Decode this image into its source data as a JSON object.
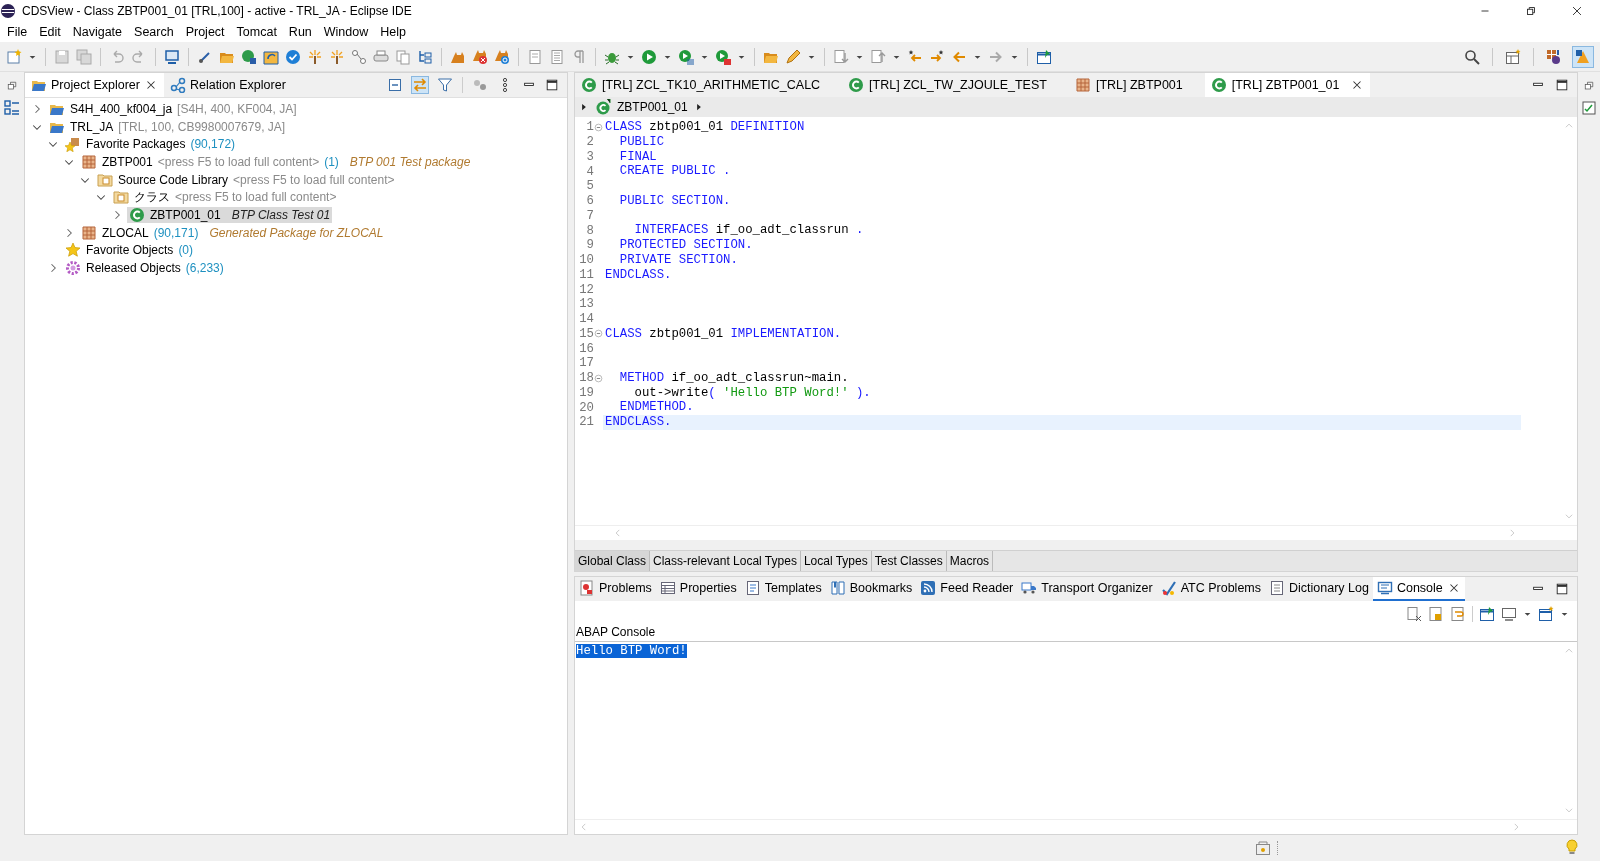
{
  "window": {
    "title": "CDSView - Class ZBTP001_01 [TRL,100] - active - TRL_JA - Eclipse IDE"
  },
  "menu": [
    "File",
    "Edit",
    "Navigate",
    "Search",
    "Project",
    "Tomcat",
    "Run",
    "Window",
    "Help"
  ],
  "explorer": {
    "tabs": [
      {
        "label": "Project Explorer",
        "kind": "project",
        "selected": true
      },
      {
        "label": "Relation Explorer",
        "kind": "relation",
        "selected": false
      }
    ],
    "tree": [
      {
        "label": "S4H_400_kf004_ja",
        "detail": "[S4H, 400, KF004, JA]",
        "kind": "project",
        "expanded": false,
        "selected": false
      },
      {
        "label": "TRL_JA",
        "detail": "[TRL, 100, CB9980007679, JA]",
        "kind": "project",
        "expanded": true,
        "selected": false,
        "children": [
          {
            "label": "Favorite Packages",
            "count": "(90,172)",
            "kind": "favorites",
            "expanded": true,
            "selected": false,
            "children": [
              {
                "label": "ZBTP001",
                "detail": "<press F5 to load full content>",
                "count": "(1)",
                "description": "BTP 001 Test package",
                "kind": "package",
                "expanded": true,
                "selected": false,
                "children": [
                  {
                    "label": "Source Code Library",
                    "detail": "<press F5 to load full content>",
                    "kind": "library",
                    "expanded": true,
                    "selected": false,
                    "children": [
                      {
                        "label": "クラス",
                        "detail": "<press F5 to load full content>",
                        "kind": "folder",
                        "expanded": true,
                        "selected": false,
                        "children": [
                          {
                            "label": "ZBTP001_01",
                            "description": "BTP Class Test 01",
                            "kind": "class",
                            "expanded": false,
                            "selected": true
                          }
                        ]
                      }
                    ]
                  }
                ]
              },
              {
                "label": "ZLOCAL",
                "count": "(90,171)",
                "description": "Generated Package for ZLOCAL",
                "kind": "package",
                "expanded": false,
                "selected": false
              }
            ]
          },
          {
            "label": "Favorite Objects",
            "count": "(0)",
            "kind": "star",
            "selected": false
          },
          {
            "label": "Released Objects",
            "count": "(6,233)",
            "kind": "gear",
            "expanded": false,
            "selected": false
          }
        ]
      }
    ]
  },
  "editor": {
    "tabs": [
      {
        "label": "[TRL] ZCL_TK10_ARITHMETIC_CALC",
        "kind": "class",
        "selected": false
      },
      {
        "label": "[TRL] ZCL_TW_ZJOULE_TEST",
        "kind": "class",
        "selected": false
      },
      {
        "label": "[TRL] ZBTP001",
        "kind": "package",
        "selected": false
      },
      {
        "label": "[TRL] ZBTP001_01",
        "kind": "class",
        "selected": true
      }
    ],
    "breadcrumb": "ZBTP001_01",
    "lines": [
      {
        "number": "1",
        "fold": true,
        "current": false,
        "tokens": [
          {
            "kind": "keyword",
            "text": "CLASS"
          },
          {
            "kind": "plain",
            "text": " zbtp001_01 "
          },
          {
            "kind": "keyword",
            "text": "DEFINITION"
          }
        ]
      },
      {
        "number": "2",
        "fold": false,
        "current": false,
        "tokens": [
          {
            "kind": "keyword",
            "text": "  PUBLIC"
          }
        ]
      },
      {
        "number": "3",
        "fold": false,
        "current": false,
        "tokens": [
          {
            "kind": "keyword",
            "text": "  FINAL"
          }
        ]
      },
      {
        "number": "4",
        "fold": false,
        "current": false,
        "tokens": [
          {
            "kind": "keyword",
            "text": "  CREATE PUBLIC ."
          }
        ]
      },
      {
        "number": "5",
        "fold": false,
        "current": false
      },
      {
        "number": "6",
        "fold": false,
        "current": false,
        "tokens": [
          {
            "kind": "keyword",
            "text": "  PUBLIC SECTION."
          }
        ]
      },
      {
        "number": "7",
        "fold": false,
        "current": false
      },
      {
        "number": "8",
        "fold": false,
        "current": false,
        "tokens": [
          {
            "kind": "keyword",
            "text": "    INTERFACES"
          },
          {
            "kind": "plain",
            "text": " if_oo_adt_classrun "
          },
          {
            "kind": "keyword",
            "text": "."
          }
        ]
      },
      {
        "number": "9",
        "fold": false,
        "current": false,
        "tokens": [
          {
            "kind": "keyword",
            "text": "  PROTECTED SECTION."
          }
        ]
      },
      {
        "number": "10",
        "fold": false,
        "current": false,
        "tokens": [
          {
            "kind": "keyword",
            "text": "  PRIVATE SECTION."
          }
        ]
      },
      {
        "number": "11",
        "fold": false,
        "current": false,
        "tokens": [
          {
            "kind": "keyword",
            "text": "ENDCLASS."
          }
        ]
      },
      {
        "number": "12",
        "fold": false,
        "current": false
      },
      {
        "number": "13",
        "fold": false,
        "current": false
      },
      {
        "number": "14",
        "fold": false,
        "current": false
      },
      {
        "number": "15",
        "fold": true,
        "current": false,
        "tokens": [
          {
            "kind": "keyword",
            "text": "CLASS"
          },
          {
            "kind": "plain",
            "text": " zbtp001_01 "
          },
          {
            "kind": "keyword",
            "text": "IMPLEMENTATION."
          }
        ]
      },
      {
        "number": "16",
        "fold": false,
        "current": false
      },
      {
        "number": "17",
        "fold": false,
        "current": false
      },
      {
        "number": "18",
        "fold": true,
        "current": false,
        "tokens": [
          {
            "kind": "keyword",
            "text": "  METHOD"
          },
          {
            "kind": "plain",
            "text": " if_oo_adt_classrun~main."
          }
        ]
      },
      {
        "number": "19",
        "fold": false,
        "current": false,
        "tokens": [
          {
            "kind": "plain",
            "text": "    out->write"
          },
          {
            "kind": "keyword",
            "text": "("
          },
          {
            "kind": "string",
            "text": " 'Hello BTP Word!'"
          },
          {
            "kind": "keyword",
            "text": " )."
          }
        ]
      },
      {
        "number": "20",
        "fold": false,
        "current": false,
        "tokens": [
          {
            "kind": "keyword",
            "text": "  ENDMETHOD."
          }
        ]
      },
      {
        "number": "21",
        "fold": false,
        "current": true,
        "tokens": [
          {
            "kind": "keyword",
            "text": "ENDCLASS."
          }
        ]
      }
    ],
    "section_tabs": [
      {
        "label": "Global Class",
        "selected": true
      },
      {
        "label": "Class-relevant Local Types",
        "selected": false
      },
      {
        "label": "Local Types",
        "selected": false
      },
      {
        "label": "Test Classes",
        "selected": false
      },
      {
        "label": "Macros",
        "selected": false
      }
    ]
  },
  "views": {
    "tabs": [
      {
        "label": "Problems",
        "kind": "problems",
        "selected": false
      },
      {
        "label": "Properties",
        "kind": "properties",
        "selected": false
      },
      {
        "label": "Templates",
        "kind": "templates",
        "selected": false
      },
      {
        "label": "Bookmarks",
        "kind": "bookmarks",
        "selected": false
      },
      {
        "label": "Feed Reader",
        "kind": "feed",
        "selected": false
      },
      {
        "label": "Transport Organizer",
        "kind": "transport",
        "selected": false
      },
      {
        "label": "ATC Problems",
        "kind": "atc",
        "selected": false
      },
      {
        "label": "Dictionary Log",
        "kind": "log",
        "selected": false
      },
      {
        "label": "Console",
        "kind": "console",
        "selected": true
      }
    ],
    "console_title": "ABAP Console",
    "output": "Hello BTP Word!"
  }
}
